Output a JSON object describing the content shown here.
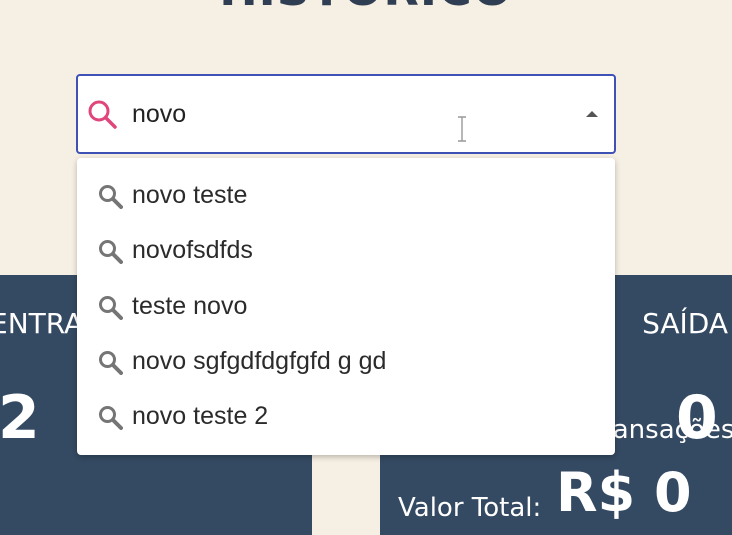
{
  "page": {
    "title": "HISTÓRICO"
  },
  "search": {
    "value": "novo",
    "placeholder": ""
  },
  "suggestions": [
    {
      "label": "novo teste"
    },
    {
      "label": "novofsdfds"
    },
    {
      "label": "teste novo"
    },
    {
      "label": "novo sgfgdfdgfgfd g gd"
    },
    {
      "label": "novo teste 2"
    }
  ],
  "cards": {
    "entrada": {
      "title": "ENTRADA",
      "big": "2"
    },
    "saida": {
      "title": "SAÍDA",
      "transacoes_label": "Transações:",
      "transacoes_value": "0",
      "valor_label": "Valor Total:",
      "valor_value": "R$ 0"
    }
  },
  "colors": {
    "background": "#f6efe3",
    "card": "#344a62",
    "focus_border": "#3f51b5",
    "search_icon": "#e0457b",
    "option_icon": "#757575"
  },
  "icons": {
    "search_main": "search-icon",
    "option": "search-icon",
    "toggle": "caret-up-icon",
    "cursor": "text-cursor-icon"
  }
}
